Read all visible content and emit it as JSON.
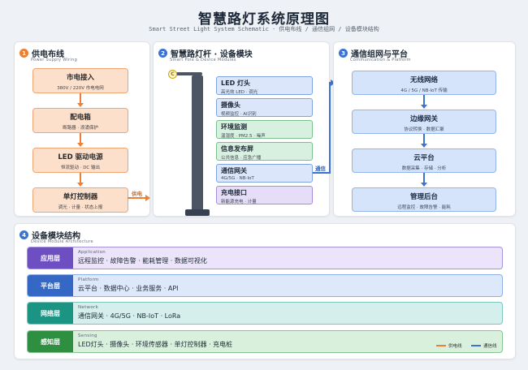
{
  "header": {
    "title": "智慧路灯系统原理图",
    "subtitle": "Smart Street Light System Schematic  ·  供电布线 / 通信组网 / 设备模块结构"
  },
  "colors": {
    "power": "#ee7e34",
    "comm": "#3b73d1",
    "step1": "#ee7e34",
    "step2": "#3b73d1",
    "step3": "#3b73d1",
    "step4": "#ee7e34"
  },
  "power": {
    "num": "1",
    "title": "供电布线",
    "subtitle": "Power Supply Wiring",
    "boxes": [
      {
        "title": "市电接入",
        "sub": "380V / 220V 市电电网"
      },
      {
        "title": "配电箱",
        "sub": "断路器 · 浪涌保护"
      },
      {
        "title": "LED 驱动电源",
        "sub": "恒流驱动 · DC 输出"
      },
      {
        "title": "单灯控制器",
        "sub": "调光 · 计量 · 状态上报"
      }
    ],
    "link_label": "供电"
  },
  "pole": {
    "num": "2",
    "title": "智慧路灯杆 · 设备模块",
    "subtitle": "Smart Pole & Device Modules",
    "lamp_glyph": "C",
    "modules": [
      {
        "title": "LED 灯头",
        "sub": "高光效 LED · 调光"
      },
      {
        "title": "摄像头",
        "sub": "视频监控 · AI识别"
      },
      {
        "title": "环境监测",
        "sub": "温湿度 · PM2.5 · 噪声"
      },
      {
        "title": "信息发布屏",
        "sub": "公共信息 · 应急广播"
      },
      {
        "title": "通信网关",
        "sub": "4G/5G · NB-IoT"
      },
      {
        "title": "充电接口",
        "sub": "新能源充电 · 计量"
      }
    ],
    "link_label": "通信"
  },
  "network": {
    "num": "3",
    "title": "通信组网与平台",
    "subtitle": "Communication & Platform",
    "boxes": [
      {
        "title": "无线网络",
        "sub": "4G / 5G / NB-IoT 传输"
      },
      {
        "title": "边缘网关",
        "sub": "协议转换 · 数据汇聚"
      },
      {
        "title": "云平台",
        "sub": "数据采集 · 存储 · 分析"
      },
      {
        "title": "管理后台",
        "sub": "远程监控 · 故障告警 · 能耗"
      }
    ]
  },
  "architecture": {
    "num": "4",
    "title": "设备模块结构",
    "subtitle": "Device Module Architecture",
    "layers": [
      {
        "name": "应用层",
        "en": "Application",
        "items": "远程监控 · 故障告警 · 能耗管理 · 数据可视化"
      },
      {
        "name": "平台层",
        "en": "Platform",
        "items": "云平台 · 数据中心 · 业务服务 · API"
      },
      {
        "name": "网络层",
        "en": "Network",
        "items": "通信网关 · 4G/5G · NB-IoT · LoRa"
      },
      {
        "name": "感知层",
        "en": "Sensing",
        "items": "LED灯头 · 摄像头 · 环境传感器 · 单灯控制器 · 充电桩"
      }
    ],
    "legend": [
      {
        "label": "供电线",
        "color": "#ee7e34"
      },
      {
        "label": "通信线",
        "color": "#3b73d1"
      }
    ]
  }
}
